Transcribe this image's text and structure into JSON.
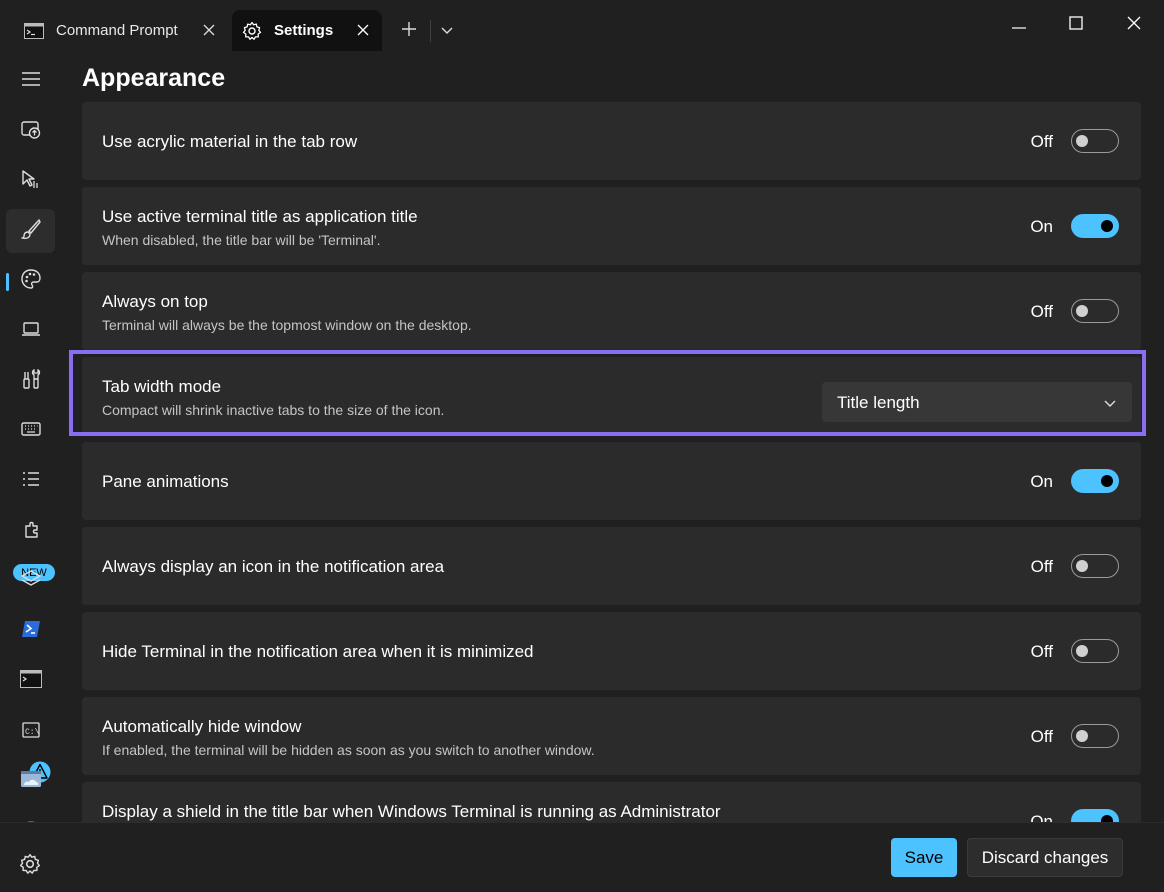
{
  "tabs": [
    {
      "label": "Command Prompt",
      "icon": "command-prompt-icon"
    },
    {
      "label": "Settings",
      "icon": "gear-icon",
      "active": true
    }
  ],
  "page": {
    "title": "Appearance"
  },
  "settings": [
    {
      "title": "Use acrylic material in the tab row",
      "state": "Off"
    },
    {
      "title": "Use active terminal title as application title",
      "desc": "When disabled, the title bar will be 'Terminal'.",
      "state": "On"
    },
    {
      "title": "Always on top",
      "desc": "Terminal will always be the topmost window on the desktop.",
      "state": "Off"
    },
    {
      "title": "Tab width mode",
      "desc": "Compact will shrink inactive tabs to the size of the icon.",
      "value": "Title length"
    },
    {
      "title": "Pane animations",
      "state": "On"
    },
    {
      "title": "Always display an icon in the notification area",
      "state": "Off"
    },
    {
      "title": "Hide Terminal in the notification area when it is minimized",
      "state": "Off"
    },
    {
      "title": "Automatically hide window",
      "desc": "If enabled, the terminal will be hidden as soon as you switch to another window.",
      "state": "Off"
    },
    {
      "title": "Display a shield in the title bar when Windows Terminal is running as Administrator",
      "state": "On"
    }
  ],
  "nav": {
    "new_badge": "NEW"
  },
  "footer": {
    "save_label": "Save",
    "discard_label": "Discard changes"
  },
  "colors": {
    "accent": "#4cc2ff",
    "highlight_outline": "#8a6ef2",
    "background": "#202020",
    "card": "#2b2b2b"
  }
}
